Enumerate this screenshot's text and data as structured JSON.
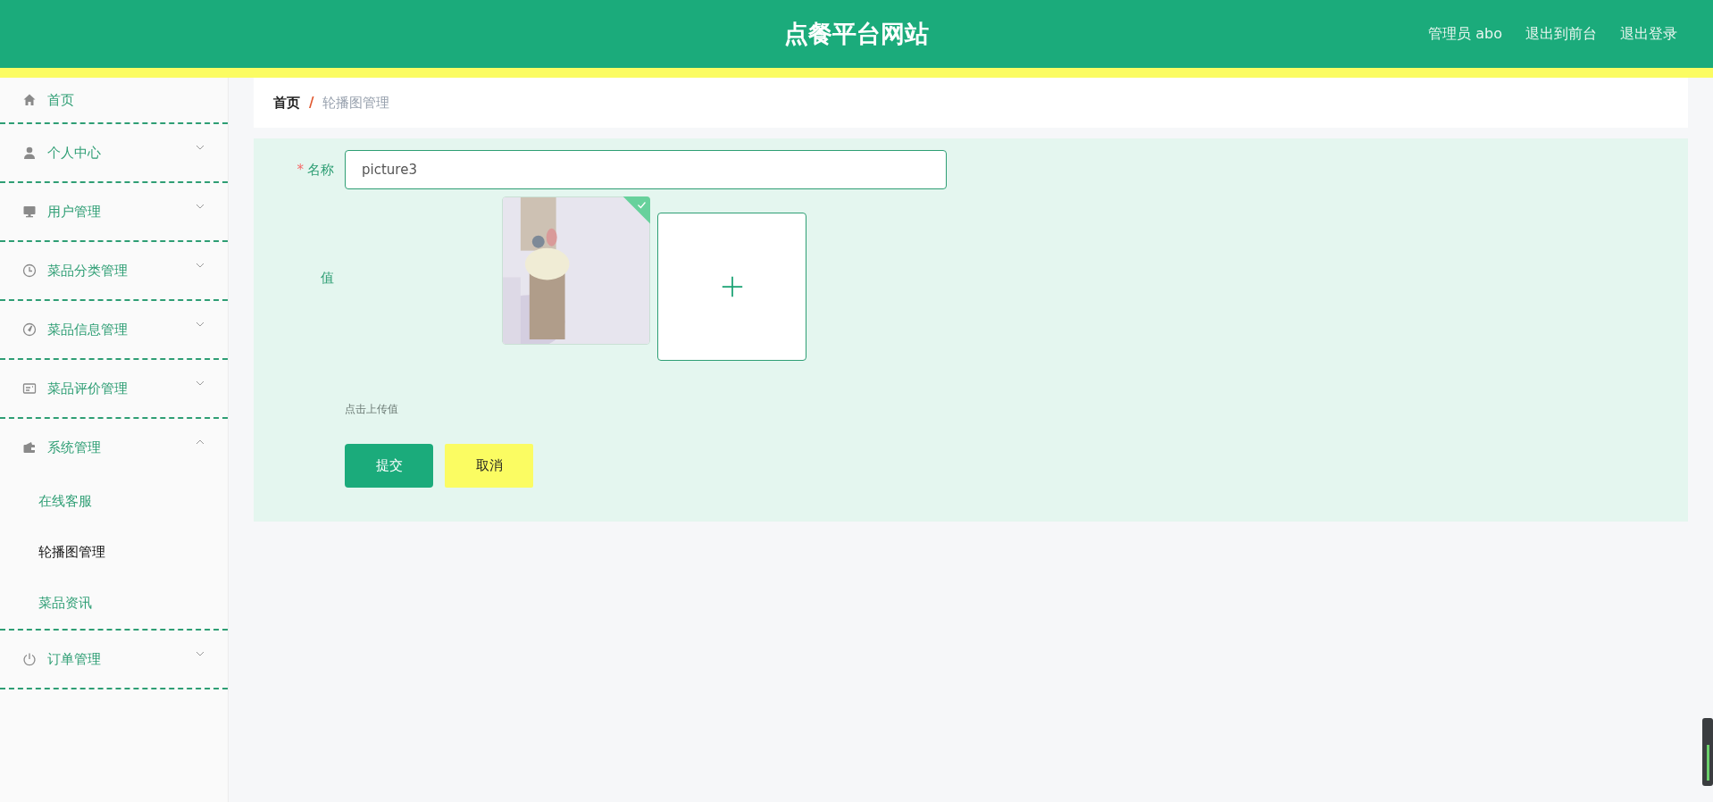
{
  "header": {
    "title": "点餐平台网站",
    "links": [
      "管理员 abo",
      "退出到前台",
      "退出登录"
    ]
  },
  "sidebar": {
    "items": [
      {
        "label": "首页"
      },
      {
        "label": "个人中心",
        "expanded": false
      },
      {
        "label": "用户管理",
        "expanded": false
      },
      {
        "label": "菜品分类管理",
        "expanded": false
      },
      {
        "label": "菜品信息管理",
        "expanded": false
      },
      {
        "label": "菜品评价管理",
        "expanded": false
      },
      {
        "label": "系统管理",
        "expanded": true,
        "children": [
          {
            "label": "在线客服",
            "selected": false
          },
          {
            "label": "轮播图管理",
            "selected": true
          },
          {
            "label": "菜品资讯",
            "selected": false
          }
        ]
      },
      {
        "label": "订单管理",
        "expanded": false
      }
    ]
  },
  "breadcrumb": {
    "separator": "/",
    "items": [
      "首页",
      "轮播图管理"
    ]
  },
  "form": {
    "fields": [
      {
        "kind": "text",
        "label": "名称",
        "required_mark": "*",
        "value": "picture3"
      },
      {
        "kind": "upload",
        "label": "值",
        "files": [
          {
            "kind": "picture",
            "success": true
          }
        ],
        "hint": "点击上传值"
      }
    ],
    "buttons": [
      {
        "label": "提交",
        "kind": "primary"
      },
      {
        "label": "取消",
        "kind": "secondary"
      }
    ]
  }
}
